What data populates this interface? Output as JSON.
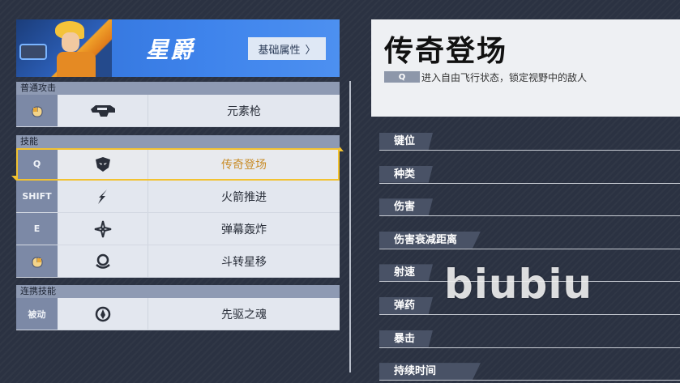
{
  "hero": {
    "name": "星爵",
    "attr_button": "基础属性",
    "attr_chevron": "〉"
  },
  "sections": {
    "normal": {
      "title": "普通攻击",
      "rows": [
        {
          "key": "mouse-icon",
          "icon": "element-gun-icon",
          "name": "元素枪"
        }
      ]
    },
    "skills": {
      "title": "技能",
      "rows": [
        {
          "key": "Q",
          "icon": "mask-icon",
          "name": "传奇登场",
          "active": true
        },
        {
          "key": "SHIFT",
          "icon": "rocket-boost-icon",
          "name": "火箭推进"
        },
        {
          "key": "E",
          "icon": "barrage-icon",
          "name": "弹幕轰炸"
        },
        {
          "key": "mouse-icon",
          "icon": "orbit-icon",
          "name": "斗转星移"
        }
      ]
    },
    "combo": {
      "title": "连携技能",
      "rows": [
        {
          "key": "被动",
          "icon": "spirit-icon",
          "name": "先驱之魂"
        }
      ]
    }
  },
  "detail": {
    "title": "传奇登场",
    "key": "Q",
    "description": "进入自由飞行状态，锁定视野中的敌人",
    "stats": [
      "键位",
      "种类",
      "伤害",
      "伤害衰减距离",
      "射速",
      "弹药",
      "暴击",
      "持续时间"
    ]
  },
  "watermark": "biubiu",
  "colors": {
    "banner": "#3f84ec",
    "active_border": "#f2c230",
    "active_text": "#c98d2a",
    "key_bg": "#7c89a6",
    "row_bg": "#e3e7ef"
  }
}
